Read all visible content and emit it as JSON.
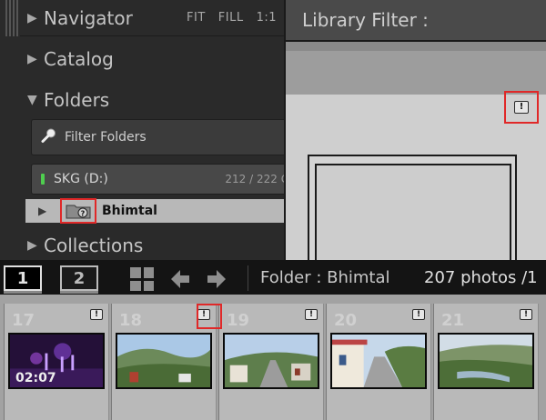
{
  "left_panel": {
    "navigator": {
      "title": "Navigator",
      "zoom": [
        "FIT",
        "FILL",
        "1:1"
      ]
    },
    "catalog": {
      "title": "Catalog"
    },
    "folders": {
      "title": "Folders"
    },
    "filter_folders": {
      "placeholder": "Filter Folders"
    },
    "volume": {
      "name": "SKG (D:)",
      "count": "212 / 222 G"
    },
    "folder_item": {
      "name": "Bhimtal"
    },
    "collections": {
      "title": "Collections"
    }
  },
  "right_panel": {
    "title": "Library Filter :"
  },
  "toolbar": {
    "screen1": "1",
    "screen2": "2",
    "folder_label": "Folder : Bhimtal",
    "photo_count": "207 photos /1"
  },
  "filmstrip": {
    "items": [
      {
        "number": "17",
        "duration": "02:07",
        "icon": "video-thumbnail"
      },
      {
        "number": "18",
        "icon": "hills-thumbnail"
      },
      {
        "number": "19",
        "icon": "street-thumbnail"
      },
      {
        "number": "20",
        "icon": "lane-thumbnail"
      },
      {
        "number": "21",
        "icon": "valley-thumbnail"
      }
    ]
  },
  "colors": {
    "highlight_box": "#e02828",
    "volume_led": "#4fce4f"
  }
}
